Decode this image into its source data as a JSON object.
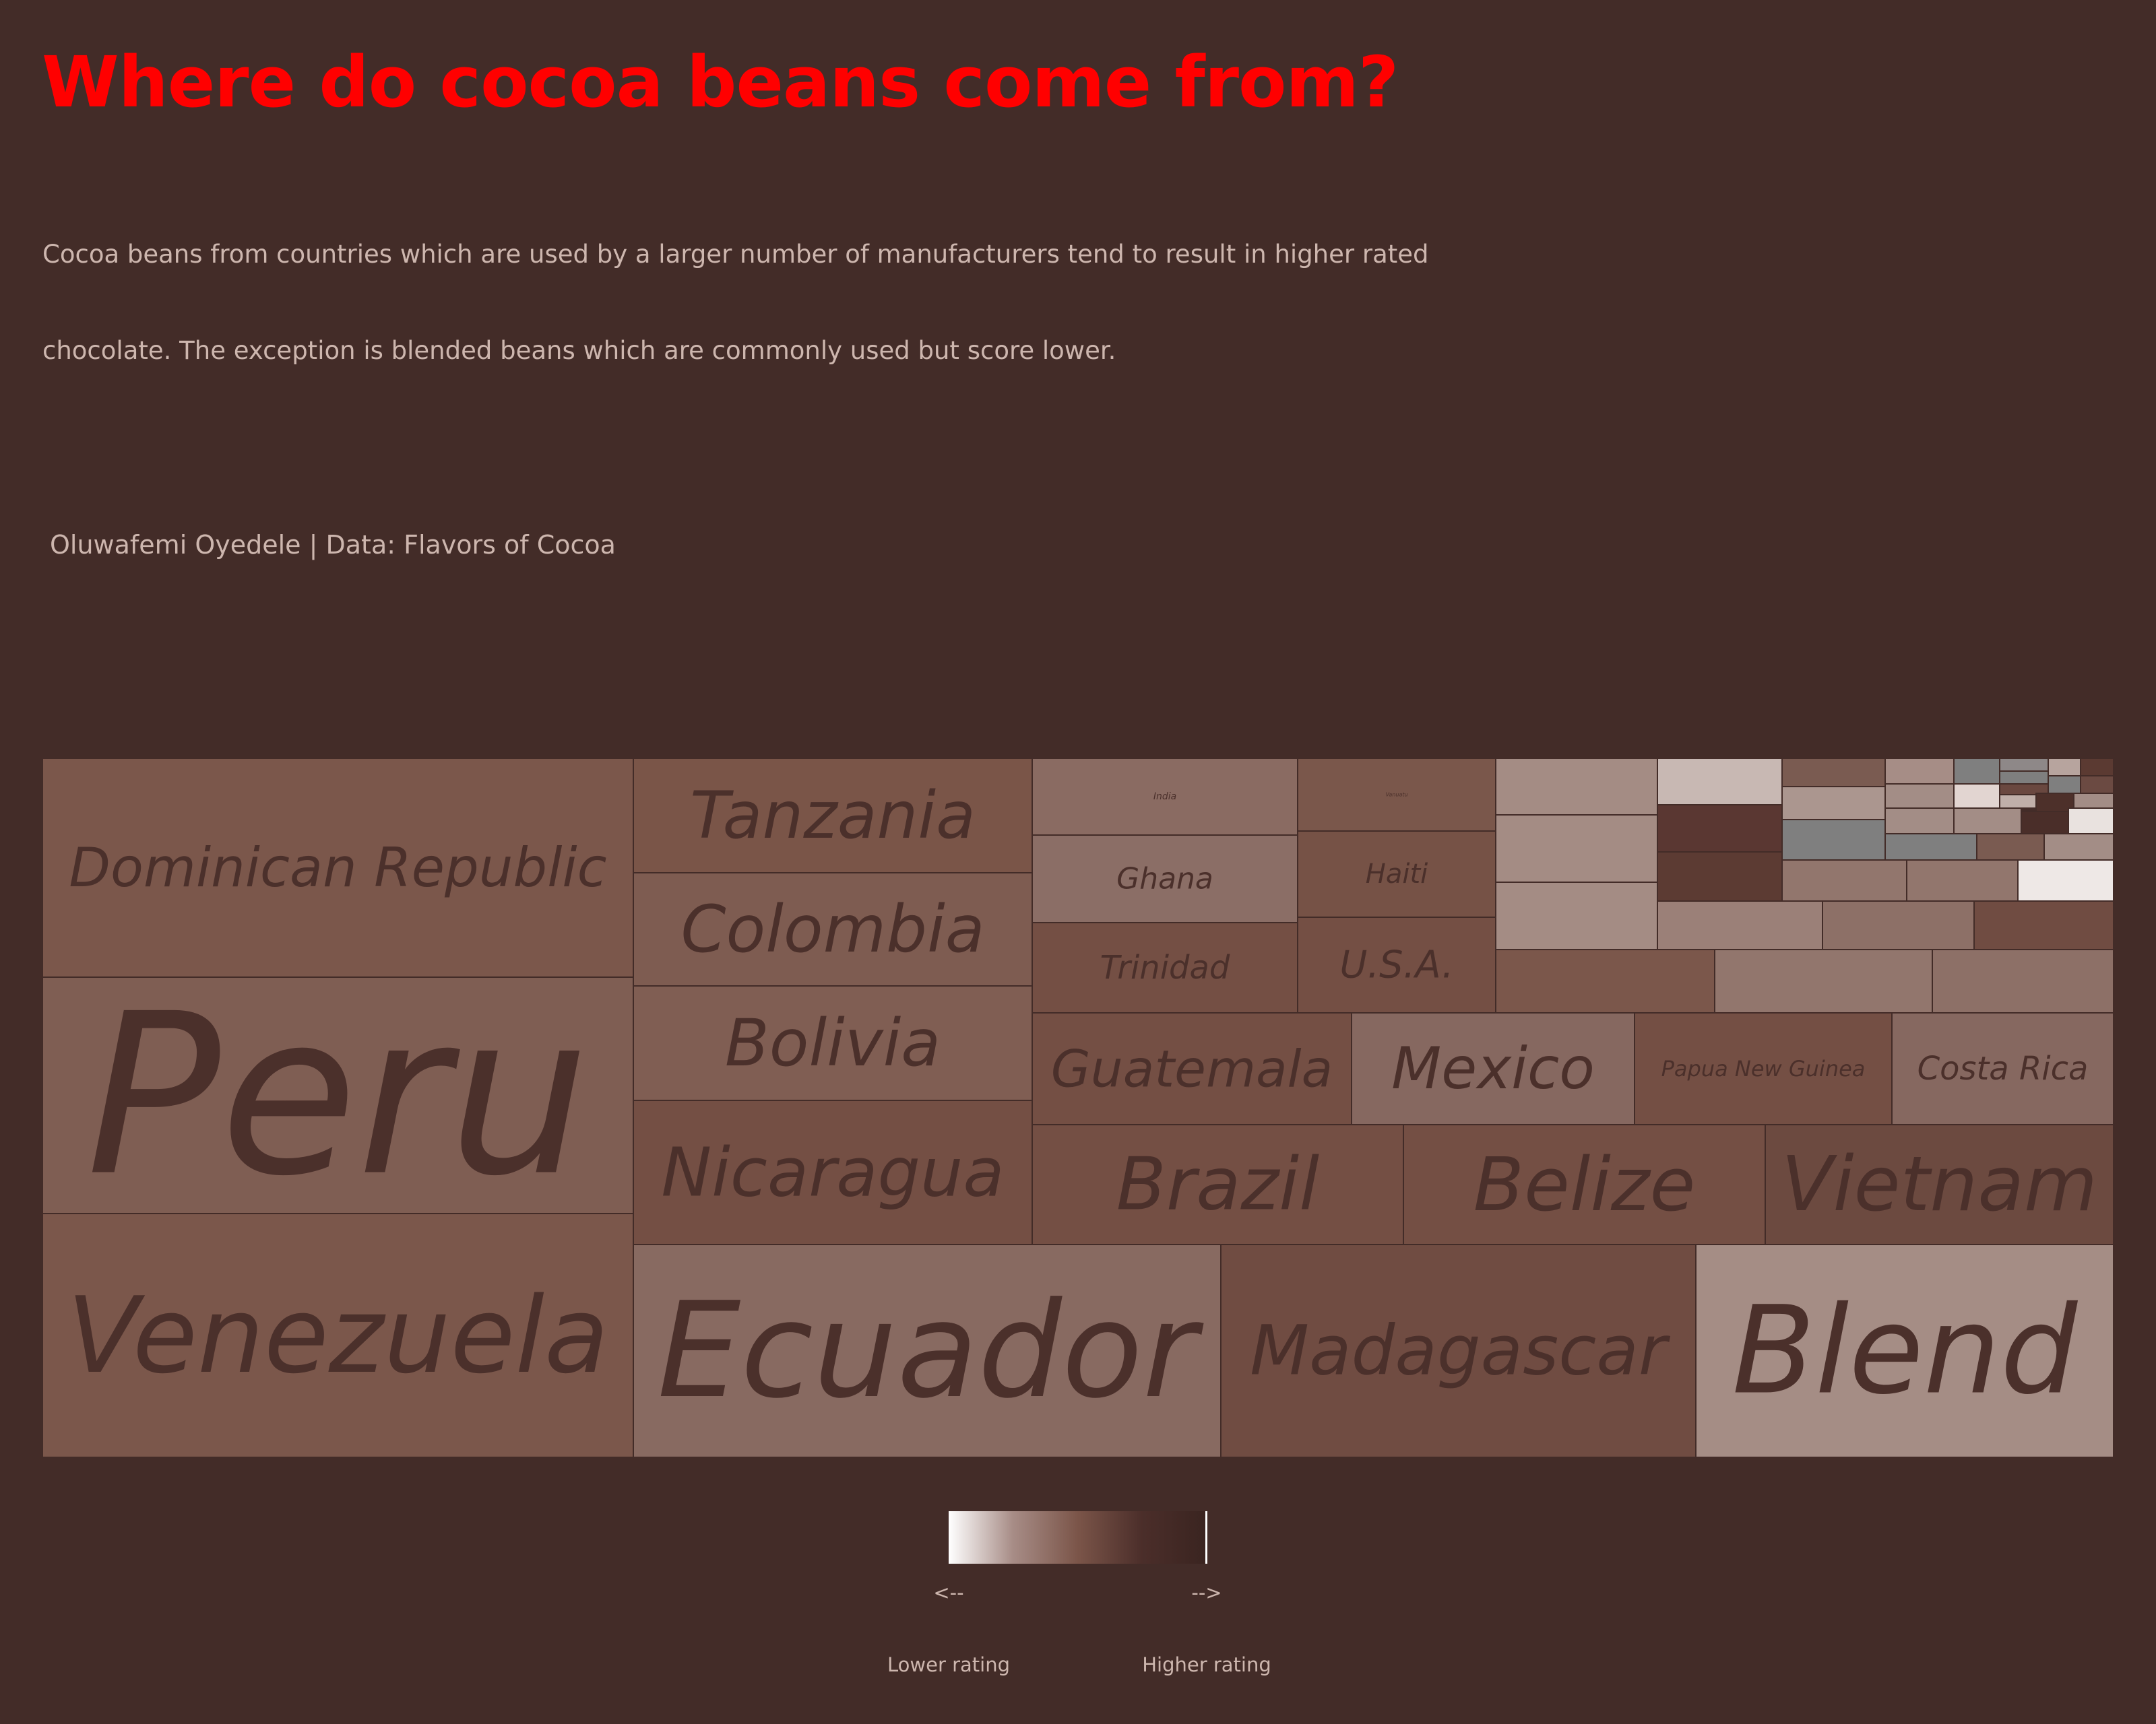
{
  "chart_data": {
    "type": "treemap",
    "title": "Where do cocoa beans come from?",
    "subtitle_lines": [
      "Cocoa beans from countries which are used by a larger number of manufacturers tend to result in higher rated",
      "chocolate. The exception is blended beans which are commonly used but score lower."
    ],
    "credit": " Oluwafemi Oyedele | Data: Flavors of Cocoa",
    "title_color": "#ff0000",
    "background_color": "#432c28",
    "label_color": "#4b302b",
    "border_color": "#432c28",
    "legend": {
      "left_arrow": "<--",
      "right_arrow": "-->",
      "low_label": "Lower rating",
      "high_label": "Higher rating",
      "gradient": [
        "#ffffff",
        "#a78c86",
        "#7b5549",
        "#4b2e2a",
        "#3a2420"
      ]
    },
    "cells": [
      {
        "label": "Dominican Republic",
        "color": "#7b574b"
      },
      {
        "label": "Peru",
        "color": "#7f5e53"
      },
      {
        "label": "Venezuela",
        "color": "#7b574b"
      },
      {
        "label": "Tanzania",
        "color": "#7a5548"
      },
      {
        "label": "Colombia",
        "color": "#7e5c51"
      },
      {
        "label": "Bolivia",
        "color": "#805e53"
      },
      {
        "label": "Nicaragua",
        "color": "#744f44"
      },
      {
        "label": "India",
        "color": "#8a6b62"
      },
      {
        "label": "Vanuatu",
        "color": "#7a574b"
      },
      {
        "label": "Ghana",
        "color": "#8b6e66"
      },
      {
        "label": "Haiti",
        "color": "#765246"
      },
      {
        "label": "Trinidad",
        "color": "#744f44"
      },
      {
        "label": "U.S.A.",
        "color": "#744f44"
      },
      {
        "label": "Guatemala",
        "color": "#744f44"
      },
      {
        "label": "Mexico",
        "color": "#866860"
      },
      {
        "label": "Papua New Guinea",
        "color": "#744f44"
      },
      {
        "label": "Costa Rica",
        "color": "#866860"
      },
      {
        "label": "Brazil",
        "color": "#744f44"
      },
      {
        "label": "Belize",
        "color": "#744f44"
      },
      {
        "label": "Vietnam",
        "color": "#6c4a40"
      },
      {
        "label": "Ecuador",
        "color": "#886a61"
      },
      {
        "label": "Madagascar",
        "color": "#704c42"
      },
      {
        "label": "Blend",
        "color": "#a58d85"
      }
    ]
  }
}
